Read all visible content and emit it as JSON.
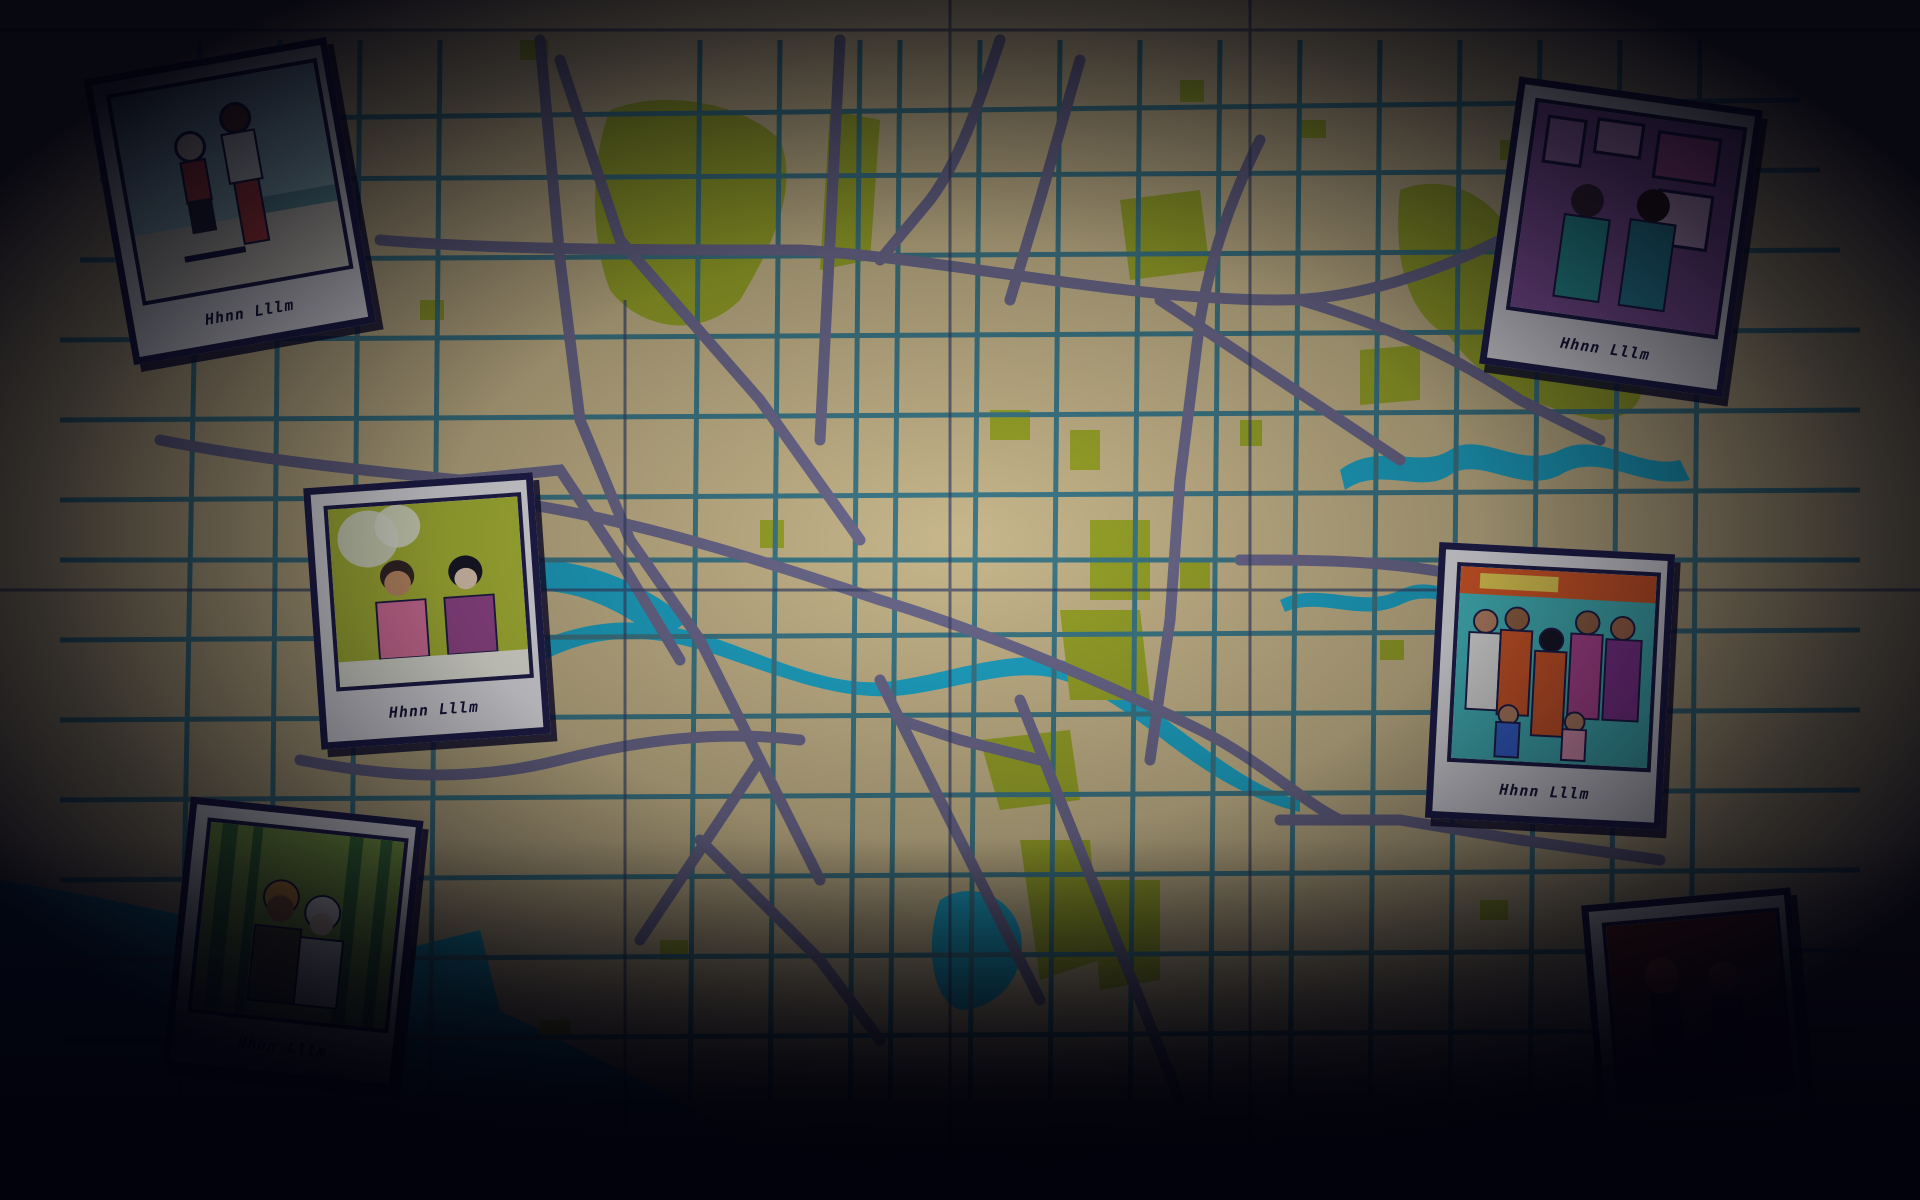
{
  "scene": {
    "name": "memory-map-screen",
    "colors": {
      "land": "#c8b78c",
      "park": "#9aa62a",
      "water": "#1fa7c9",
      "major_road": "#6d6a8e",
      "minor_road": "#3e7a8a",
      "ink": "#222050",
      "polaroid_paper": "#ecebf1",
      "vignette": "#05050d"
    }
  },
  "photos": [
    {
      "id": "skatepark",
      "caption": "Hhnn Lllm",
      "icon": "skater-kids-photo",
      "palette": [
        "#a9d6de",
        "#e5e0d0",
        "#c84646"
      ]
    },
    {
      "id": "gallery",
      "caption": "Hhnn Lllm",
      "icon": "art-gallery-photo",
      "palette": [
        "#b880c8",
        "#8e5aa8",
        "#2ea6a6"
      ]
    },
    {
      "id": "cafe",
      "caption": "Hhnn Lllm",
      "icon": "couple-cafe-photo",
      "palette": [
        "#b4c23a",
        "#e87aa6",
        "#9c4b92"
      ]
    },
    {
      "id": "family",
      "caption": "Hhnn Lllm",
      "icon": "group-family-photo",
      "palette": [
        "#e25e2c",
        "#c14da0",
        "#49c3c9"
      ]
    },
    {
      "id": "forest",
      "caption": "Hhnn Lllm",
      "icon": "forest-selfie-photo",
      "palette": [
        "#8ab04a",
        "#3e7a3e",
        "#e0a040"
      ]
    },
    {
      "id": "night",
      "caption": "",
      "icon": "concert-photo",
      "palette": [
        "#6b2a1a",
        "#3a1a2a",
        "#a24a2a"
      ]
    }
  ]
}
